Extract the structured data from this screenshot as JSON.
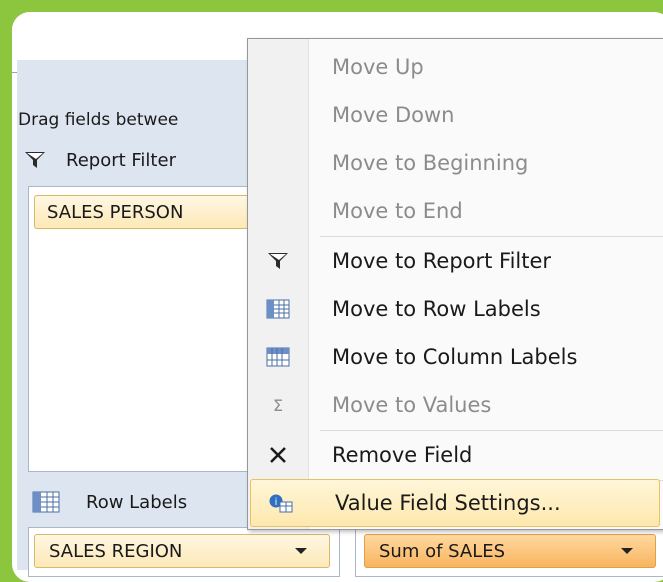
{
  "field_list": {
    "drag_text": "Drag fields betwee",
    "report_filter_label": "Report Filter",
    "report_filter_field": "SALES PERSON",
    "row_labels_label": "Row Labels",
    "row_labels_field": "SALES REGION",
    "values_field": "Sum of SALES"
  },
  "context_menu": {
    "items": [
      {
        "label": "Move Up",
        "icon": "",
        "enabled": false
      },
      {
        "label": "Move Down",
        "icon": "",
        "enabled": false
      },
      {
        "label": "Move to Beginning",
        "icon": "",
        "enabled": false
      },
      {
        "label": "Move to End",
        "icon": "",
        "enabled": false
      },
      {
        "label": "Move to Report Filter",
        "icon": "filter-icon",
        "enabled": true
      },
      {
        "label": "Move to Row Labels",
        "icon": "row-labels-icon",
        "enabled": true
      },
      {
        "label": "Move to Column Labels",
        "icon": "column-labels-icon",
        "enabled": true
      },
      {
        "label": "Move to Values",
        "icon": "sigma-icon",
        "enabled": false
      },
      {
        "label": "Remove Field",
        "icon": "close-icon",
        "enabled": true
      },
      {
        "label": "Value Field Settings...",
        "icon": "value-field-settings-icon",
        "enabled": true,
        "highlighted": true
      }
    ]
  }
}
